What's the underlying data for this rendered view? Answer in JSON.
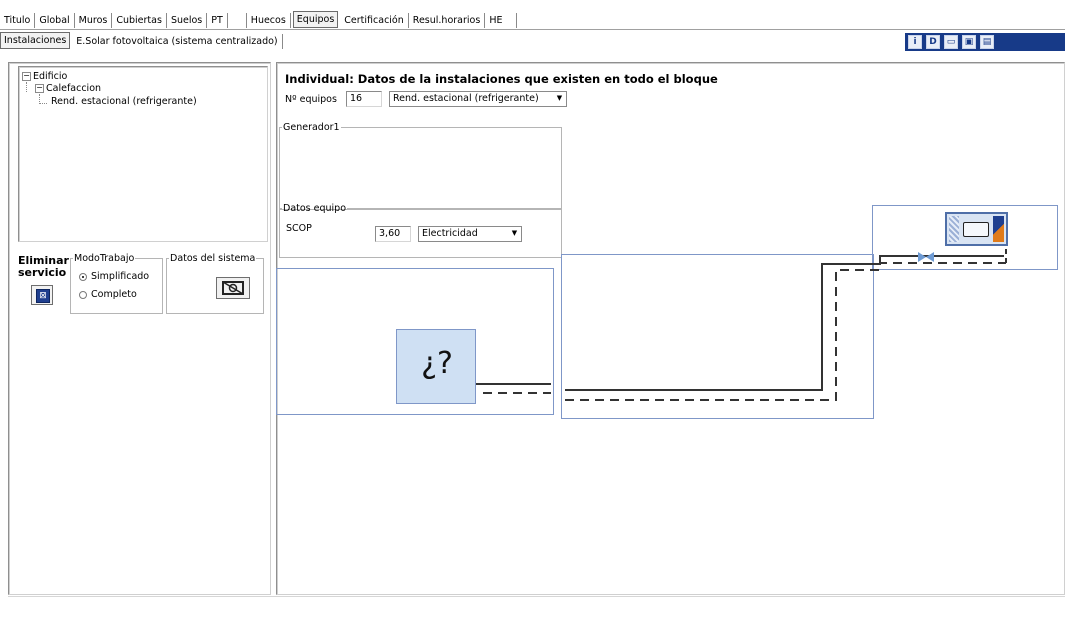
{
  "top_tabs": [
    {
      "label": "Titulo",
      "active": false
    },
    {
      "label": "Global",
      "active": false
    },
    {
      "label": "Muros",
      "active": false
    },
    {
      "label": "Cubiertas",
      "active": false
    },
    {
      "label": "Suelos",
      "active": false
    },
    {
      "label": "PT",
      "active": false
    },
    {
      "label": "Huecos",
      "active": false
    },
    {
      "label": "Equipos",
      "active": true
    },
    {
      "label": "Certificación",
      "active": false
    },
    {
      "label": "Resul.horarios",
      "active": false
    },
    {
      "label": "HE",
      "active": false
    }
  ],
  "sub_tabs": [
    {
      "label": "Instalaciones",
      "active": true
    },
    {
      "label": "E.Solar fotovoltaica (sistema centralizado)",
      "active": false
    }
  ],
  "toolbar": {
    "background": "#173a88",
    "buttons": [
      {
        "icon": "info-icon",
        "glyph": "i"
      },
      {
        "icon": "document-icon",
        "glyph": "D"
      },
      {
        "icon": "open-folder-icon",
        "glyph": "▭"
      },
      {
        "icon": "save-icon",
        "glyph": "▣"
      },
      {
        "icon": "copy-icon",
        "glyph": "▤"
      }
    ]
  },
  "tree": {
    "root": "Edificio",
    "child": "Calefaccion",
    "leaf": "Rend. estacional (refrigerante)"
  },
  "left_controls": {
    "delete_label_1": "Eliminar",
    "delete_label_2": "servicio",
    "mode_legend": "ModoTrabajo",
    "mode_simplified": "Simplificado",
    "mode_complete": "Completo",
    "mode_selected": "Simplificado",
    "system_data_legend": "Datos del sistema"
  },
  "main": {
    "title": "Individual: Datos de la instalaciones que existen en todo el bloque",
    "n_equipos_label": "Nº equipos",
    "n_equipos_value": "16",
    "equipment_type": "Rend. estacional (refrigerante)",
    "generator_legend": "Generador1",
    "equipment_data_legend": "Datos equipo",
    "scop_label": "SCOP",
    "scop_value": "3,60",
    "energy_source": "Electricidad"
  },
  "diagram": {
    "unknown_label": "¿?",
    "box_border_color": "#7f97c8",
    "unknown_fill": "#cfe0f3",
    "unit_accent": "#e07b1a"
  }
}
